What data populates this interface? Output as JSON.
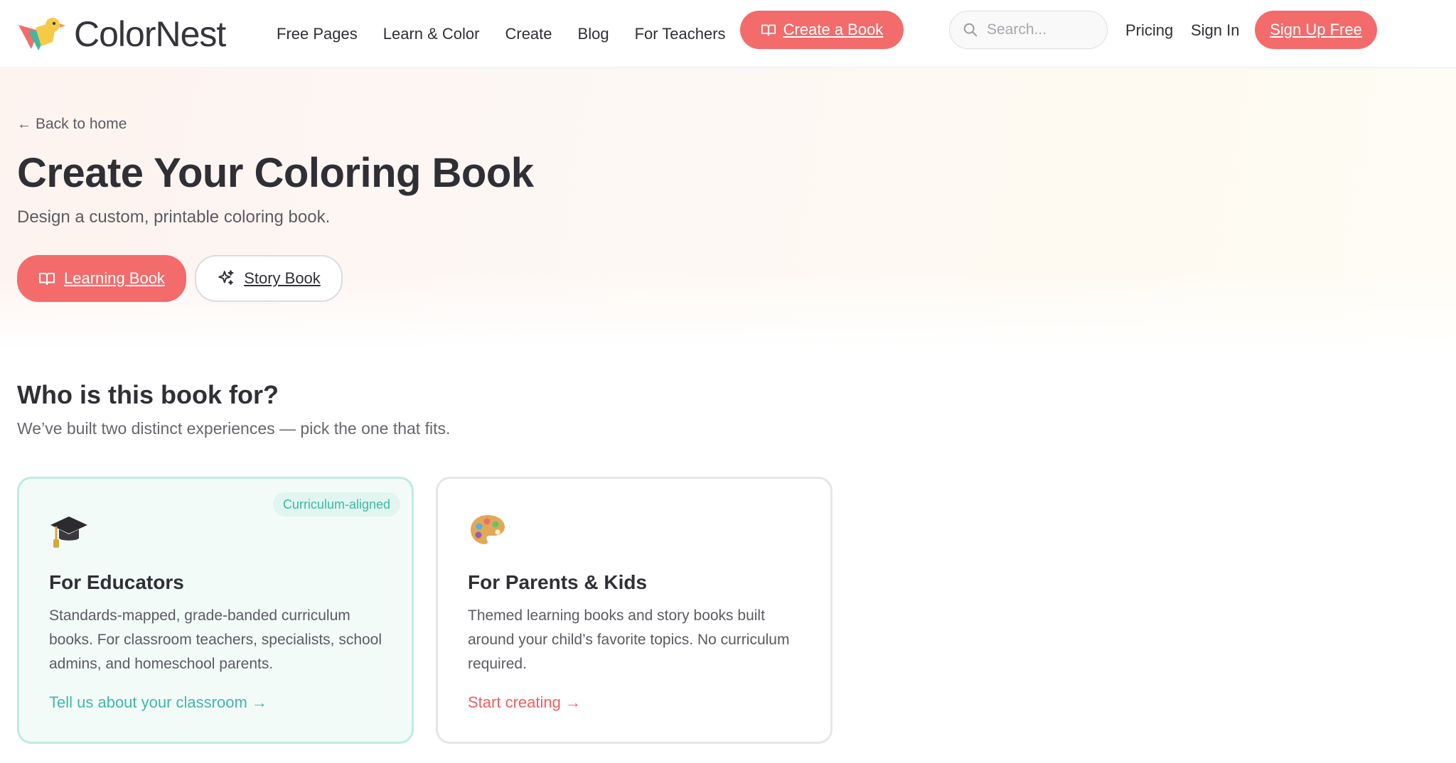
{
  "brand": {
    "name": "ColorNest",
    "accent": "#f36b6b",
    "teal": "#3fb8a5"
  },
  "nav": {
    "items": [
      {
        "label": "Free Pages"
      },
      {
        "label": "Learn & Color"
      },
      {
        "label": "Create"
      },
      {
        "label": "Blog"
      },
      {
        "label": "For Teachers"
      }
    ],
    "create_book_label": "Create a Book",
    "create_book_icon": "open-book-icon",
    "search": {
      "placeholder": "Search...",
      "value": "",
      "icon": "search-icon"
    },
    "pricing_label": "Pricing",
    "signin_label": "Sign In",
    "signup_label": "Sign Up Free"
  },
  "hero": {
    "back_label": "Back to home",
    "back_icon": "arrow-left-icon",
    "title": "Create Your Coloring Book",
    "subtitle": "Design a custom, printable coloring book.",
    "mode_tabs": [
      {
        "label": "Learning Book",
        "icon": "open-book-icon",
        "selected": true
      },
      {
        "label": "Story Book",
        "icon": "sparkles-icon",
        "selected": false
      }
    ]
  },
  "audience": {
    "title": "Who is this book for?",
    "subtitle": "We’ve built two distinct experiences — pick the one that fits.",
    "cards": [
      {
        "icon": "graduation-cap-icon",
        "badge": "Curriculum-aligned",
        "title": "For Educators",
        "description": "Standards-mapped, grade-banded curriculum books. For classroom teachers, specialists, school admins, and homeschool parents.",
        "link": "Tell us about your classroom →"
      },
      {
        "icon": "artist-palette-icon",
        "title": "For Parents & Kids",
        "description": "Themed learning books and story books built around your child’s favorite topics. No curriculum required.",
        "link": "Start creating →"
      }
    ]
  }
}
